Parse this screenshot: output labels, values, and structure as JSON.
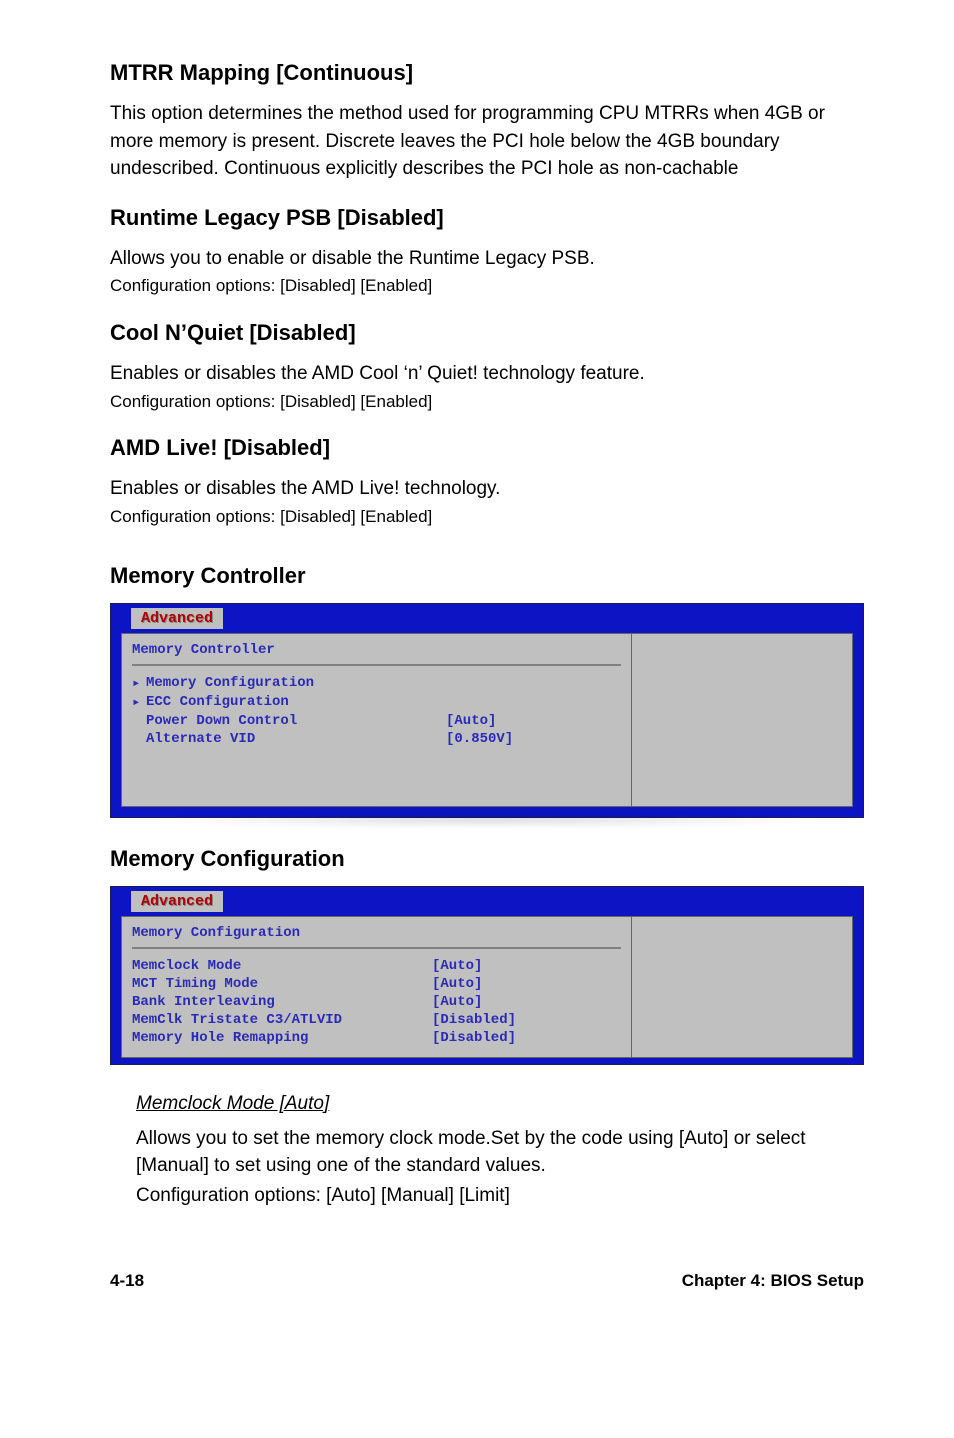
{
  "sec1": {
    "h": "MTRR Mapping [Continuous]",
    "p": "This option determines the method used for programming CPU MTRRs when 4GB or more memory is present. Discrete leaves the PCI hole below the 4GB boundary undescribed. Continuous explicitly describes the PCI hole as non-cachable"
  },
  "sec2": {
    "h": "Runtime Legacy PSB [Disabled]",
    "p1": "Allows you to enable or disable the Runtime Legacy PSB.",
    "p2": "Configuration options: [Disabled] [Enabled]"
  },
  "sec3": {
    "h": "Cool N’Quiet [Disabled]",
    "p1": "Enables or disables the AMD Cool ‘n’ Quiet! technology feature.",
    "p2": "Configuration options: [Disabled] [Enabled]"
  },
  "sec4": {
    "h": "AMD Live! [Disabled]",
    "p1": "Enables or disables the AMD Live! technology.",
    "p2": "Configuration options: [Disabled] [Enabled]"
  },
  "memctrl": {
    "h": "Memory Controller",
    "tab": "Advanced",
    "title": "Memory Controller",
    "rows": [
      {
        "arrow": "▸",
        "label": "Memory Configuration",
        "val": ""
      },
      {
        "arrow": "▸",
        "label": "ECC Configuration",
        "val": ""
      },
      {
        "arrow": "",
        "label": "Power Down Control",
        "val": "[Auto]"
      },
      {
        "arrow": "",
        "label": "Alternate VID",
        "val": "[0.850V]"
      }
    ]
  },
  "memcfg": {
    "h": "Memory Configuration",
    "tab": "Advanced",
    "title": "Memory Configuration",
    "rows": [
      {
        "label": "Memclock Mode",
        "val": "[Auto]"
      },
      {
        "label": "MCT Timing Mode",
        "val": "[Auto]"
      },
      {
        "label": "Bank Interleaving",
        "val": "[Auto]"
      },
      {
        "label": "MemClk Tristate C3/ATLVID",
        "val": "[Disabled]"
      },
      {
        "label": "Memory Hole Remapping",
        "val": "[Disabled]"
      }
    ]
  },
  "memclk": {
    "h": "Memclock Mode [Auto]",
    "p1": "Allows you to set the memory clock mode.Set by the code using [Auto] or select [Manual] to set using one of the standard values.",
    "p2": "Configuration options: [Auto] [Manual] [Limit]"
  },
  "footer": {
    "left": "4-18",
    "right": "Chapter 4: BIOS Setup"
  }
}
